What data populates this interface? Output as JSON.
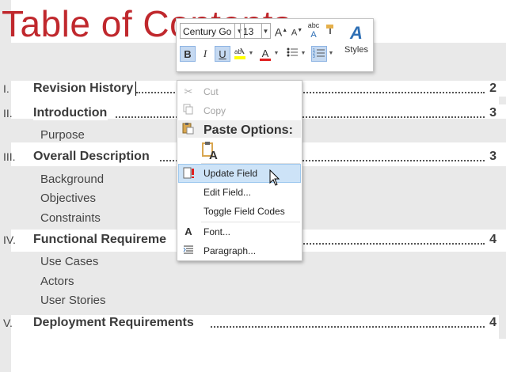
{
  "document": {
    "title": "Table of Contents",
    "toc": [
      {
        "roman": "I.",
        "label": "Revision History",
        "page": "2"
      },
      {
        "roman": "II.",
        "label": "Introduction",
        "page": "3"
      },
      {
        "roman": "III.",
        "label": "Overall Description",
        "page": "3"
      },
      {
        "roman": "IV.",
        "label": "Functional Requireme",
        "page": "4"
      },
      {
        "roman": "V.",
        "label": "Deployment Requirements",
        "page": "4"
      }
    ],
    "sub_items": {
      "introduction": [
        "Purpose"
      ],
      "overall_description": [
        "Background",
        "Objectives",
        "Constraints"
      ],
      "functional": [
        "Use Cases",
        "Actors",
        "User Stories"
      ]
    }
  },
  "mini_toolbar": {
    "font_name": "Century Go",
    "font_size": "13",
    "grow_font": "A",
    "shrink_font": "A",
    "bold": "B",
    "italic": "I",
    "underline": "U",
    "font_color": "A",
    "styles_label": "Styles",
    "styles_glyph": "A",
    "abc_label": "abc"
  },
  "context_menu": {
    "items": {
      "cut": "Cut",
      "copy": "Copy",
      "paste_options": "Paste Options:",
      "update_field": "Update Field",
      "edit_field": "Edit Field...",
      "toggle_field_codes": "Toggle Field Codes",
      "font": "Font...",
      "paragraph": "Paragraph..."
    },
    "paste_glyph": "A",
    "font_icon_glyph": "A"
  },
  "colors": {
    "title_red": "#c0282d",
    "highlight_blue": "#cde3f7",
    "font_color_red": "#e02020",
    "highlight_yellow": "#ffff00"
  }
}
